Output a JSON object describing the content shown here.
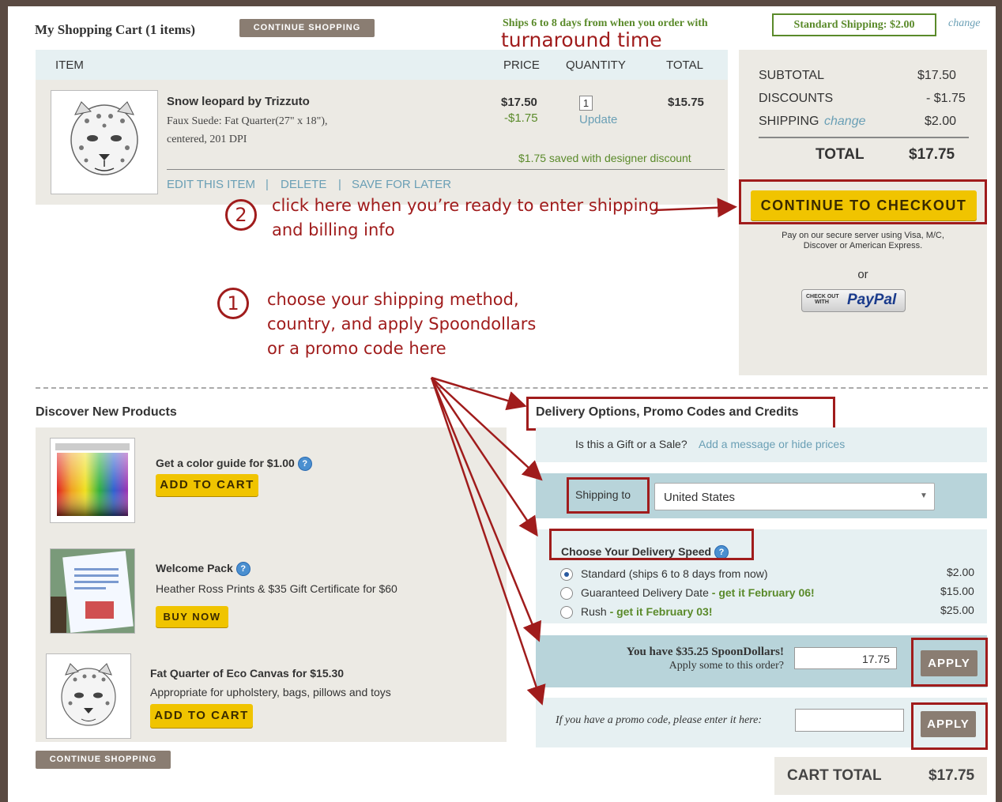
{
  "header": {
    "title": "My Shopping Cart (1 items)",
    "continue_label": "CONTINUE SHOPPING",
    "ships_text": "Ships 6 to 8 days from when you order with",
    "shipping_badge": "Standard Shipping: $2.00",
    "change_label": "change",
    "turnaround": "turnaround time"
  },
  "cart": {
    "columns": [
      "ITEM",
      "PRICE",
      "QUANTITY",
      "TOTAL"
    ],
    "item": {
      "name": "Snow leopard by Trizzuto",
      "desc1": "Faux Suede: Fat Quarter(27\" x 18\"),",
      "desc2": "centered, 201 DPI",
      "price": "$17.50",
      "discount": "-$1.75",
      "qty": "1",
      "update": "Update",
      "total": "$15.75",
      "saved": "$1.75 saved with designer discount",
      "edit": "EDIT THIS ITEM",
      "delete": "DELETE",
      "save_later": "SAVE FOR LATER",
      "sep": "|"
    }
  },
  "summary": {
    "subtotal_label": "SUBTOTAL",
    "subtotal": "$17.50",
    "discounts_label": "DISCOUNTS",
    "discounts": "- $1.75",
    "shipping_label": "SHIPPING",
    "shipping_change": "change",
    "shipping": "$2.00",
    "total_label": "TOTAL",
    "total": "$17.75",
    "checkout_label": "CONTINUE TO CHECKOUT",
    "secure_text1": "Pay on our secure server using Visa, M/C,",
    "secure_text2": "Discover or American Express.",
    "or": "or",
    "paypal_small1": "CHECK OUT",
    "paypal_small2": "WITH",
    "paypal_logo": "PayPal"
  },
  "annotations": {
    "step2_num": "2",
    "step2_line1": "click here when you’re ready to enter shipping",
    "step2_line2": "and billing info",
    "step1_num": "1",
    "step1_line1": "choose your shipping method,",
    "step1_line2": "country, and apply Spoondollars",
    "step1_line3": "or a promo code here"
  },
  "discover": {
    "title": "Discover New Products",
    "products": [
      {
        "title": "Get a color guide for $1.00",
        "button": "ADD TO CART"
      },
      {
        "title": "Welcome Pack",
        "subtitle": "Heather Ross Prints & $35 Gift Certificate for $60",
        "button": "BUY NOW"
      },
      {
        "title": "Fat Quarter of Eco Canvas for $15.30",
        "subtitle": "Appropriate for upholstery, bags, pillows and toys",
        "button": "ADD TO CART"
      }
    ],
    "continue_label": "CONTINUE SHOPPING"
  },
  "delivery": {
    "title": "Delivery Options, Promo Codes and Credits",
    "gift_question": "Is this a Gift or a Sale?",
    "gift_link": "Add a message or hide prices",
    "shipping_to_label": "Shipping to",
    "country": "United States",
    "speed_title": "Choose Your Delivery Speed",
    "options": [
      {
        "label": "Standard (ships 6 to 8 days from now)",
        "extra": "",
        "price": "$2.00",
        "selected": true
      },
      {
        "label": "Guaranteed Delivery Date",
        "extra": " - get it February 06!",
        "price": "$15.00",
        "selected": false
      },
      {
        "label": "Rush",
        "extra": " - get it February 03!",
        "price": "$25.00",
        "selected": false
      }
    ],
    "spoondollars_line1": "You have $35.25 SpoonDollars!",
    "spoondollars_line2": "Apply some to this order?",
    "spoondollars_value": "17.75",
    "apply_label": "APPLY",
    "promo_prompt": "If you have a promo code, please enter it here:",
    "promo_value": "",
    "cart_total_label": "CART TOTAL",
    "cart_total": "$17.75"
  },
  "colors": {
    "accent_red": "#a01c1c",
    "checkout_yellow": "#f0c400",
    "link_blue": "#6a9fb5",
    "green": "#5a8a2a"
  }
}
